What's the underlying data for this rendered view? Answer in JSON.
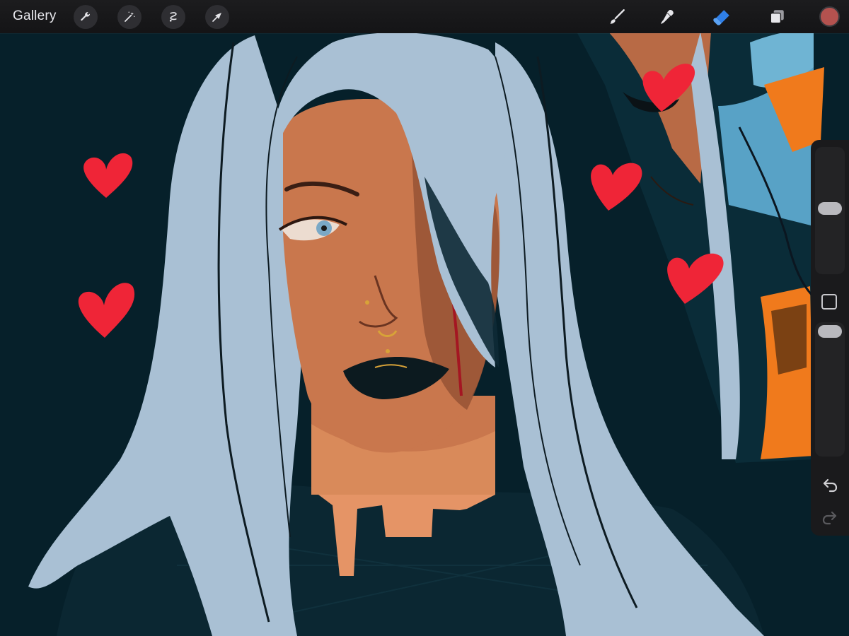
{
  "topbar": {
    "gallery_label": "Gallery",
    "left_tools": [
      "wrench-icon",
      "magic-wand-icon",
      "selection-icon",
      "transform-arrow-icon"
    ],
    "right_tools": [
      "brush-icon",
      "smudge-icon",
      "eraser-icon",
      "layers-icon"
    ],
    "current_color": "#b4524f"
  },
  "sidebar": {
    "brush_size": 0.52,
    "opacity": 1.0,
    "modify_icon": "square-icon",
    "undo_icon": "undo-icon",
    "redo_icon": "redo-icon"
  },
  "colors": {
    "background": "#06202a",
    "hair": "#a9c0d4",
    "skin": "#c9774d",
    "heart": "#ef2537",
    "accent_orange": "#f07a1c",
    "eraser_active": "#2f7fe8"
  }
}
